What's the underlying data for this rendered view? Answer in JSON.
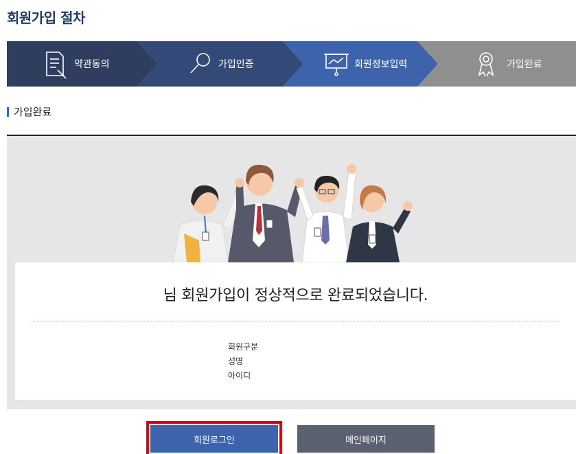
{
  "page": {
    "title": "회원가입 절차"
  },
  "steps": [
    {
      "label": "약관동의",
      "icon": "document-icon",
      "color": "#2f3e5e"
    },
    {
      "label": "가입인증",
      "icon": "magnifier-icon",
      "color": "#334a78"
    },
    {
      "label": "회원정보입력",
      "icon": "presentation-board-icon",
      "color": "#3d63ad"
    },
    {
      "label": "가입완료",
      "icon": "award-ribbon-icon",
      "color": "#8f8f8f"
    }
  ],
  "section": {
    "title": "가입완료"
  },
  "result": {
    "message": "님 회원가입이 정상적으로 완료되었습니다.",
    "fields": [
      "회원구분",
      "성명",
      "아이디"
    ]
  },
  "buttons": {
    "login": "회원로그인",
    "main": "메인페이지"
  },
  "colors": {
    "title": "#1f3c66",
    "accent": "#2d69c8",
    "login_button": "#3d63ad",
    "main_button": "#5b6170",
    "highlight": "#e0000d"
  }
}
